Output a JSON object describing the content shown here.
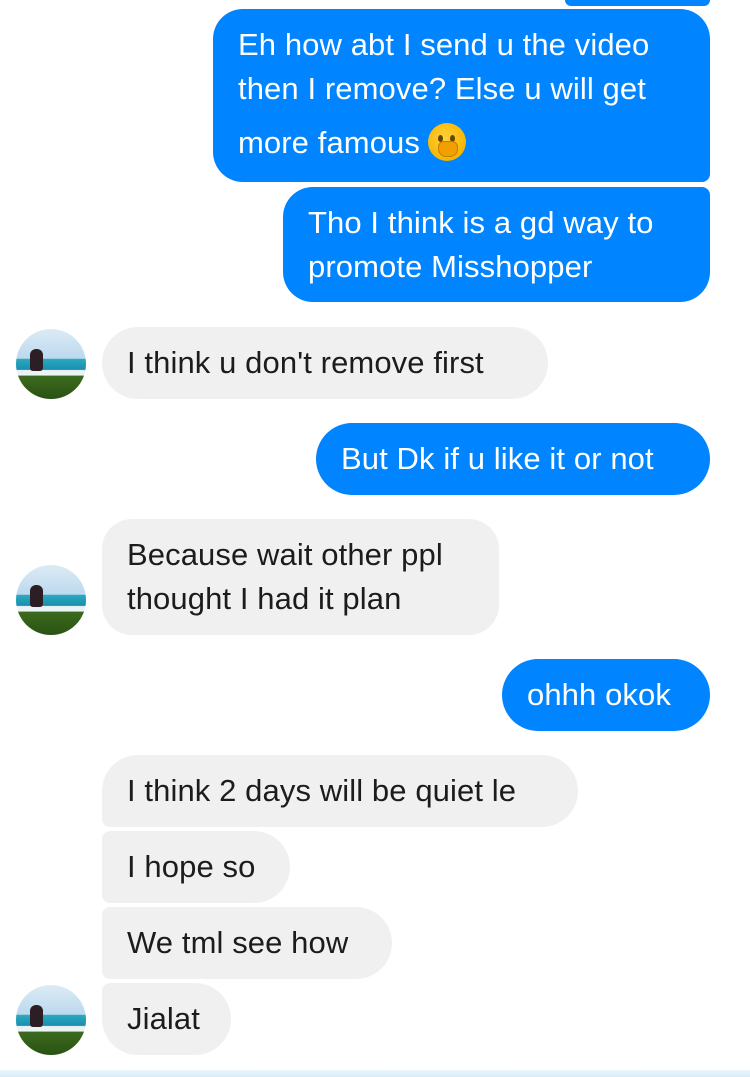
{
  "colors": {
    "outgoing": "#0084ff",
    "incoming": "#f1f0f0"
  },
  "messages": {
    "m1": {
      "lines": [
        "Eh how abt I send u the video",
        "then I remove? Else u will get",
        "more famous"
      ],
      "emoji": "hand-over-mouth-emoji"
    },
    "m2": {
      "lines": [
        "Tho I think is a gd way to",
        "promote Misshopper"
      ]
    },
    "m3": {
      "text": "I think u don't remove first"
    },
    "m4": {
      "text": "But Dk if u like it or not"
    },
    "m5": {
      "lines": [
        "Because wait other ppl",
        "thought I had it plan"
      ]
    },
    "m6": {
      "text": "ohhh okok"
    },
    "m7": {
      "text": "I think 2 days will be quiet le"
    },
    "m8": {
      "text": "I hope so"
    },
    "m9": {
      "text": "We tml see how"
    },
    "m10": {
      "text": "Jialat"
    }
  }
}
